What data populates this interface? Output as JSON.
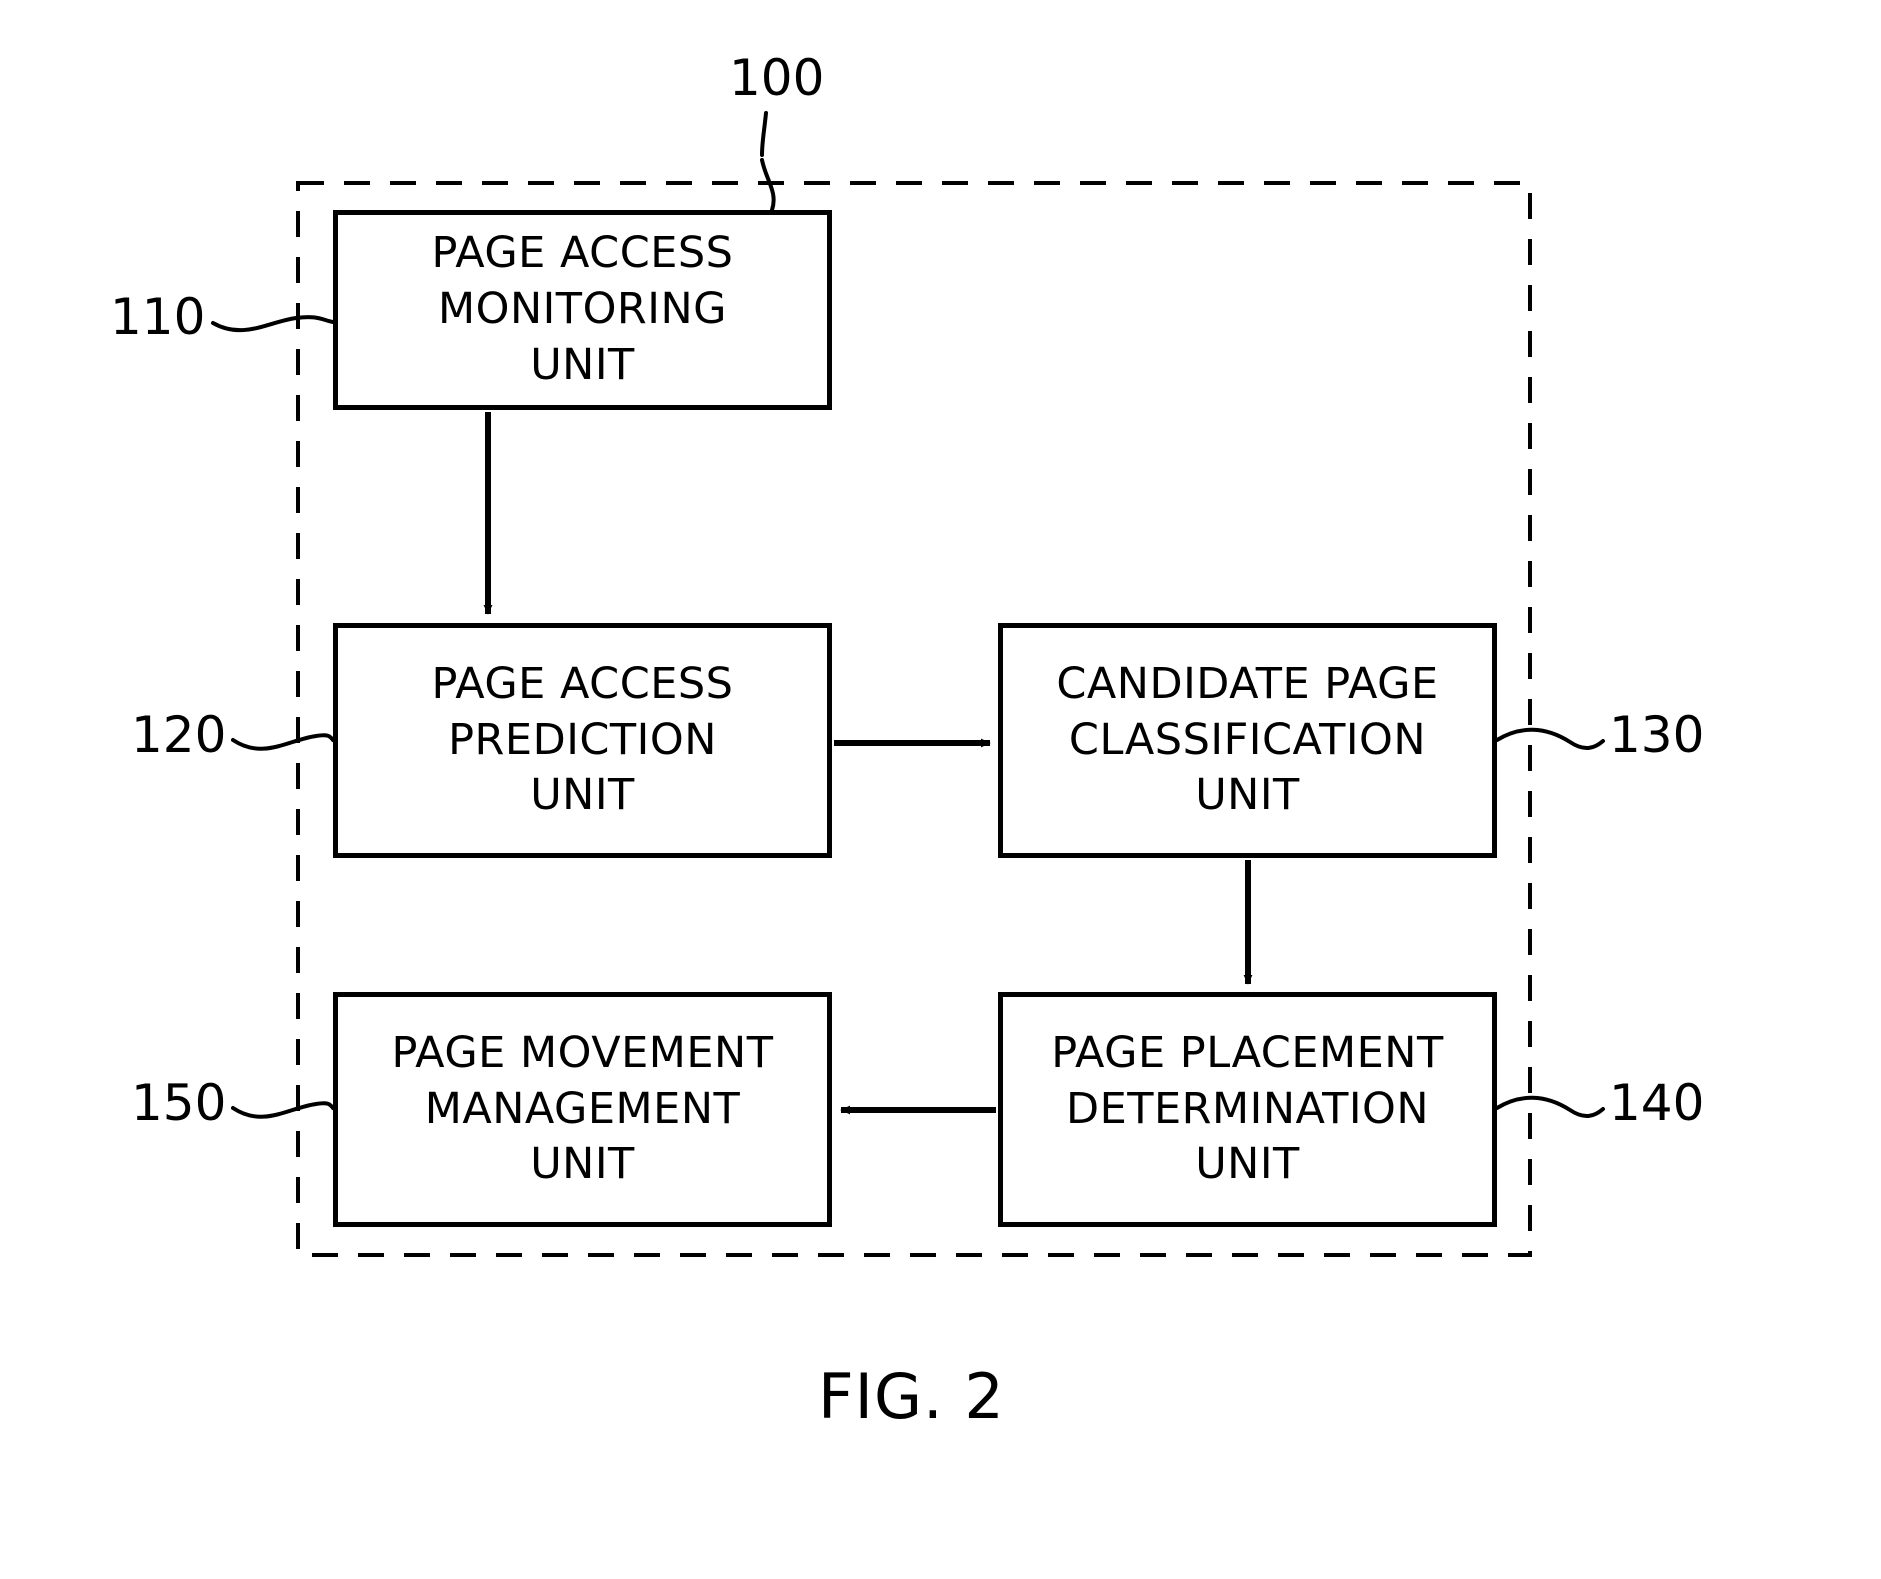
{
  "figure": {
    "caption": "FIG. 2",
    "system_ref": "100"
  },
  "boxes": [
    {
      "ref": "110",
      "lines": [
        "PAGE ACCESS",
        "MONITORING",
        "UNIT"
      ],
      "ref_side": "left"
    },
    {
      "ref": "120",
      "lines": [
        "PAGE ACCESS",
        "PREDICTION",
        "UNIT"
      ],
      "ref_side": "left"
    },
    {
      "ref": "130",
      "lines": [
        "CANDIDATE PAGE",
        "CLASSIFICATION",
        "UNIT"
      ],
      "ref_side": "right"
    },
    {
      "ref": "140",
      "lines": [
        "PAGE PLACEMENT",
        "DETERMINATION",
        "UNIT"
      ],
      "ref_side": "right"
    },
    {
      "ref": "150",
      "lines": [
        "PAGE MOVEMENT",
        "MANAGEMENT",
        "UNIT"
      ],
      "ref_side": "left"
    }
  ],
  "colors": {
    "stroke": "#000000",
    "background": "#ffffff"
  }
}
